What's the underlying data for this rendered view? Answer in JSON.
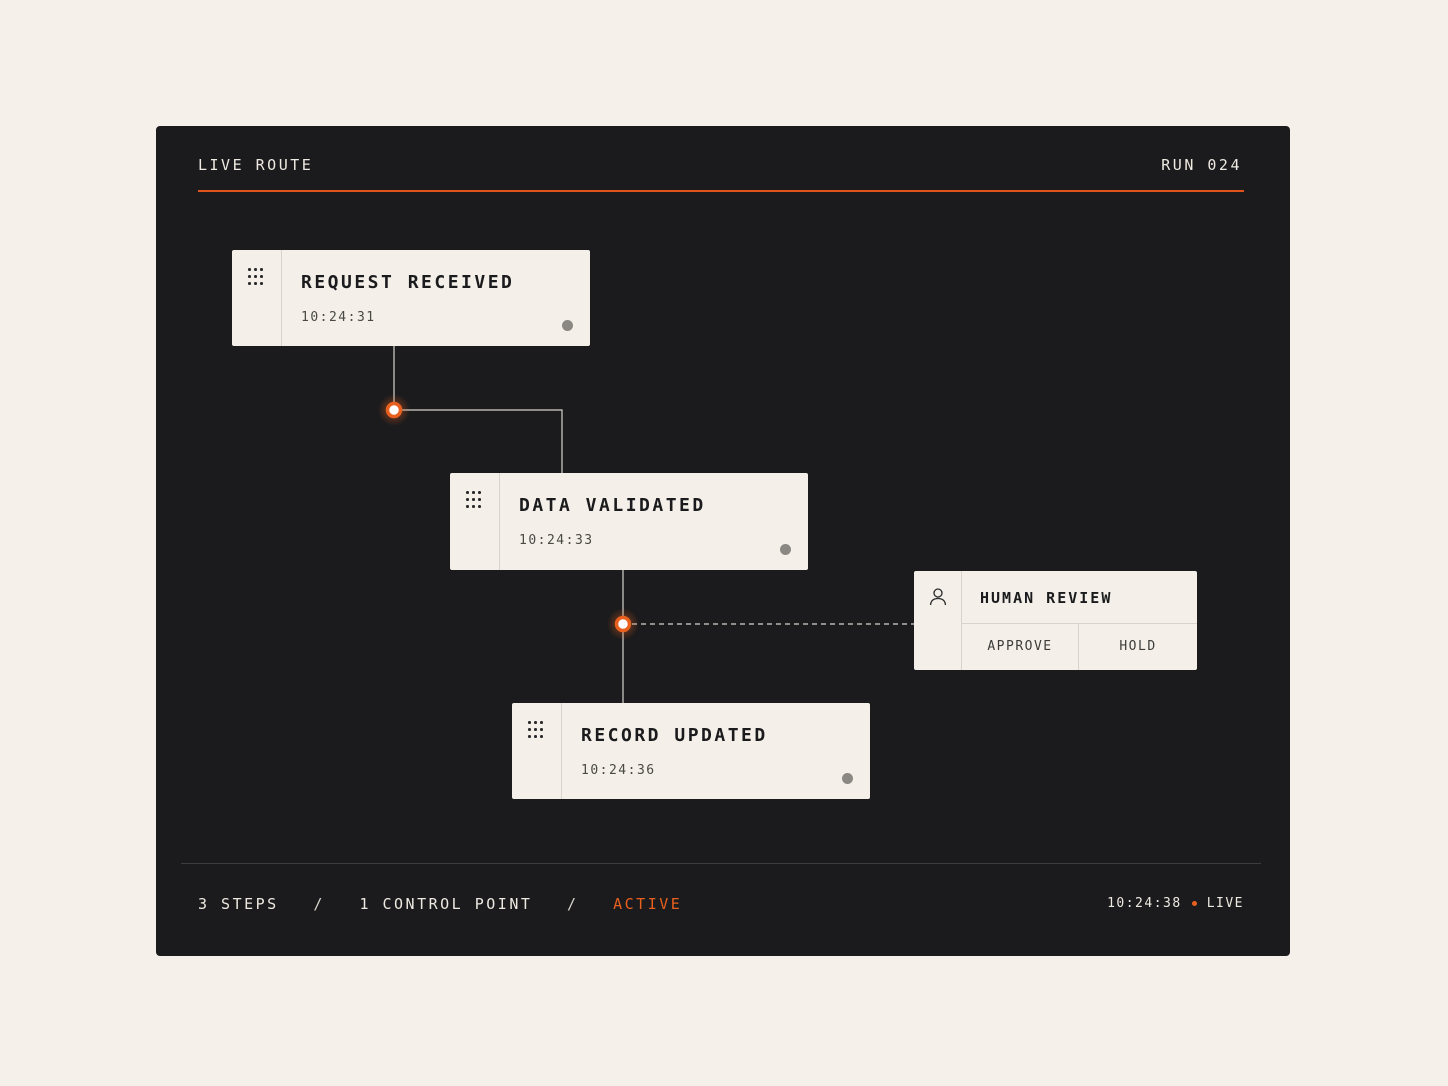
{
  "header": {
    "title": "LIVE ROUTE",
    "run": "RUN 024"
  },
  "colors": {
    "accent": "#e8601e",
    "panel": "#1b1b1d",
    "card": "#f4f0e9",
    "background": "#f5f1ea"
  },
  "nodes": [
    {
      "title": "REQUEST RECEIVED",
      "time": "10:24:31",
      "icon": "grip-icon"
    },
    {
      "title": "DATA VALIDATED",
      "time": "10:24:33",
      "icon": "grip-icon"
    },
    {
      "title": "RECORD UPDATED",
      "time": "10:24:36",
      "icon": "grip-icon"
    }
  ],
  "control_point": {
    "title": "HUMAN REVIEW",
    "icon": "person-icon",
    "actions": [
      "APPROVE",
      "HOLD"
    ]
  },
  "footer": {
    "steps": "3 STEPS",
    "control_points": "1 CONTROL POINT",
    "separator": "/",
    "state": "ACTIVE",
    "clock": "10:24:38",
    "live": "LIVE"
  }
}
